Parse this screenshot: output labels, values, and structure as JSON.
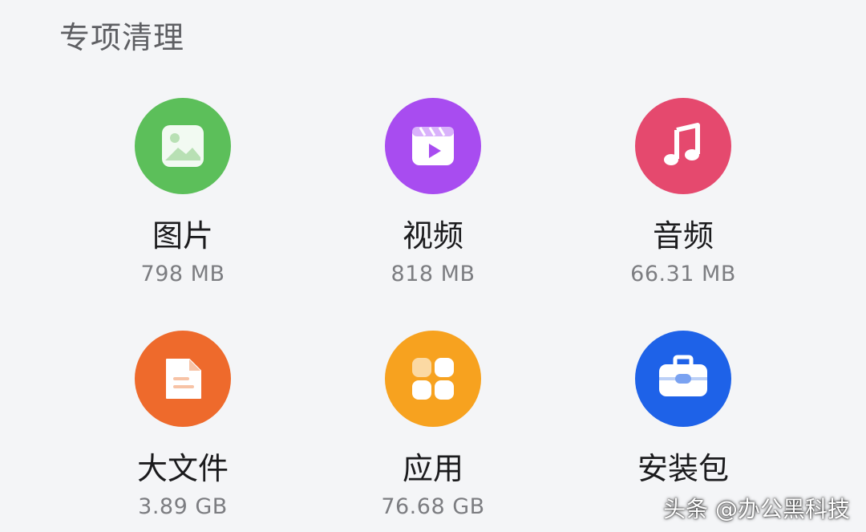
{
  "section": {
    "title": "专项清理"
  },
  "items": [
    {
      "label": "图片",
      "size": "798 MB",
      "icon": "image-icon",
      "color": "#5cbf5a"
    },
    {
      "label": "视频",
      "size": "818 MB",
      "icon": "video-icon",
      "color": "#a84cf0"
    },
    {
      "label": "音频",
      "size": "66.31 MB",
      "icon": "music-icon",
      "color": "#e5496e"
    },
    {
      "label": "大文件",
      "size": "3.89 GB",
      "icon": "document-icon",
      "color": "#ee6a2c"
    },
    {
      "label": "应用",
      "size": "76.68 GB",
      "icon": "apps-grid-icon",
      "color": "#f7a21f"
    },
    {
      "label": "安装包",
      "size": "",
      "icon": "package-icon",
      "color": "#1e62e8"
    }
  ],
  "watermark": {
    "text": "头条 @办公黑科技"
  }
}
